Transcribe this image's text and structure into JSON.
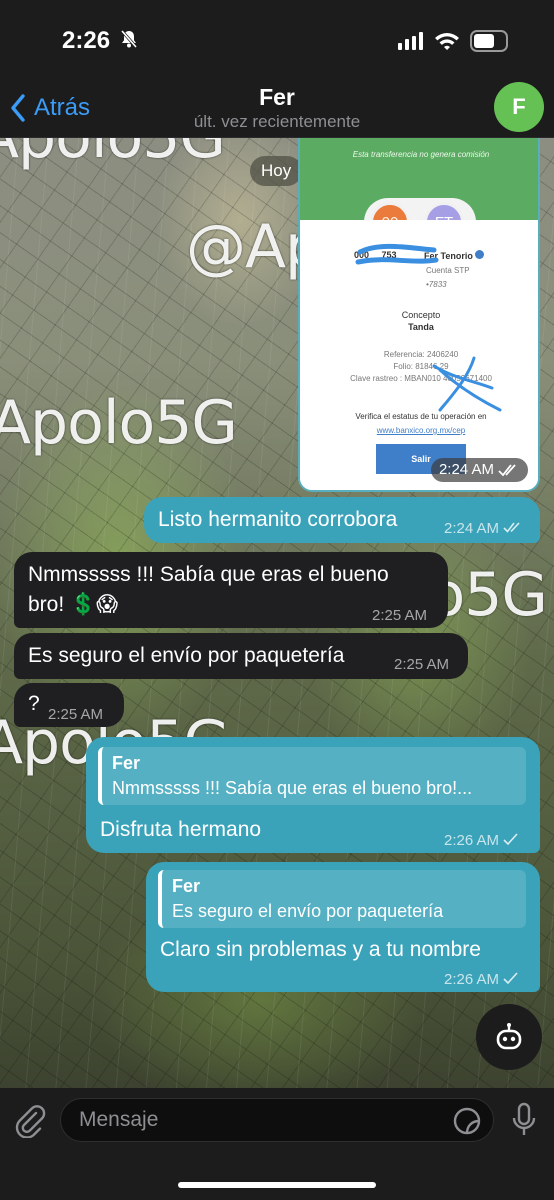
{
  "status": {
    "time": "2:26"
  },
  "nav": {
    "back_label": "Atrás",
    "title": "Fer",
    "subtitle": "últ. vez recientemente",
    "avatar_letter": "F",
    "avatar_color": "#66c154"
  },
  "wallpaper": {
    "watermarks": [
      "Apolo5G",
      "@Apolo5G",
      "Apolo5G",
      "Apolo5G",
      "Apolo5G"
    ]
  },
  "date_pill": "Hoy",
  "image_message": {
    "header_text": "Esta transferencia no genera comisión",
    "initials_from": "00",
    "initials_to": "FT",
    "account_partial": "000",
    "account_end": "753",
    "recipient_name": "Fer Tenorio",
    "recipient_bank": "Cuenta STP",
    "recipient_account": "•7833",
    "concept_label": "Concepto",
    "concept_value": "Tanda",
    "reference": "Referencia: 2406240",
    "folio": "Folio: 81846   29",
    "tracking": "Clave rastreo : MBAN010   40059671400",
    "verify_text": "Verifica el estatus de tu operación en",
    "verify_link": "www.banxico.org.mx/cep",
    "exit_button": "Salir",
    "time": "2:24 AM"
  },
  "messages": [
    {
      "dir": "out",
      "text": "Listo hermanito corrobora",
      "time": "2:24 AM"
    },
    {
      "dir": "in",
      "text_line1": "Nmmsssss !!! Sabía que eras el bueno",
      "text_line2": "bro! 💲😱",
      "time": "2:25 AM"
    },
    {
      "dir": "in",
      "text": "Es seguro el envío por paquetería",
      "time": "2:25 AM"
    },
    {
      "dir": "in",
      "text": "?",
      "time": "2:25 AM"
    },
    {
      "dir": "out",
      "reply_name": "Fer",
      "reply_text": "Nmmsssss !!! Sabía que eras el bueno bro!...",
      "text": "Disfruta hermano",
      "time": "2:26 AM"
    },
    {
      "dir": "out",
      "reply_name": "Fer",
      "reply_text": "Es seguro el envío por paquetería",
      "text": "Claro sin problemas y a tu nombre",
      "time": "2:26 AM"
    }
  ],
  "input": {
    "placeholder": "Mensaje"
  },
  "colors": {
    "outgoing": "#3aa3ba",
    "incoming": "#1f1f21",
    "accent": "#3b9cf7",
    "bar": "#1c1c1d"
  }
}
